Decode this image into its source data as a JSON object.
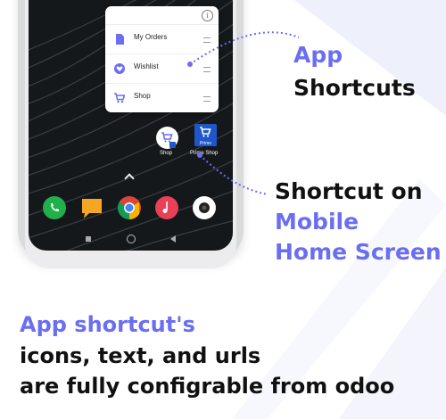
{
  "popup": {
    "items": [
      {
        "label": "My Orders",
        "icon": "document-icon"
      },
      {
        "label": "Wishlist",
        "icon": "heart-icon"
      },
      {
        "label": "Shop",
        "icon": "cart-icon"
      }
    ]
  },
  "shortcuts": {
    "shop_label": "Shop",
    "prime_label": "Prime Shop",
    "prime_badge": "Prime"
  },
  "headings": {
    "app_line1": "App",
    "app_line2": "Shortcuts",
    "home_line1": "Shortcut on",
    "home_line2": "Mobile",
    "home_line3": "Home Screen"
  },
  "caption": {
    "line1": "App shortcut's",
    "line2": "icons, text, and urls",
    "line3": "are fully configrable from odoo"
  },
  "colors": {
    "accent": "#6a6ef0",
    "dark_text": "#111111",
    "prime_blue": "#1f56c9"
  }
}
